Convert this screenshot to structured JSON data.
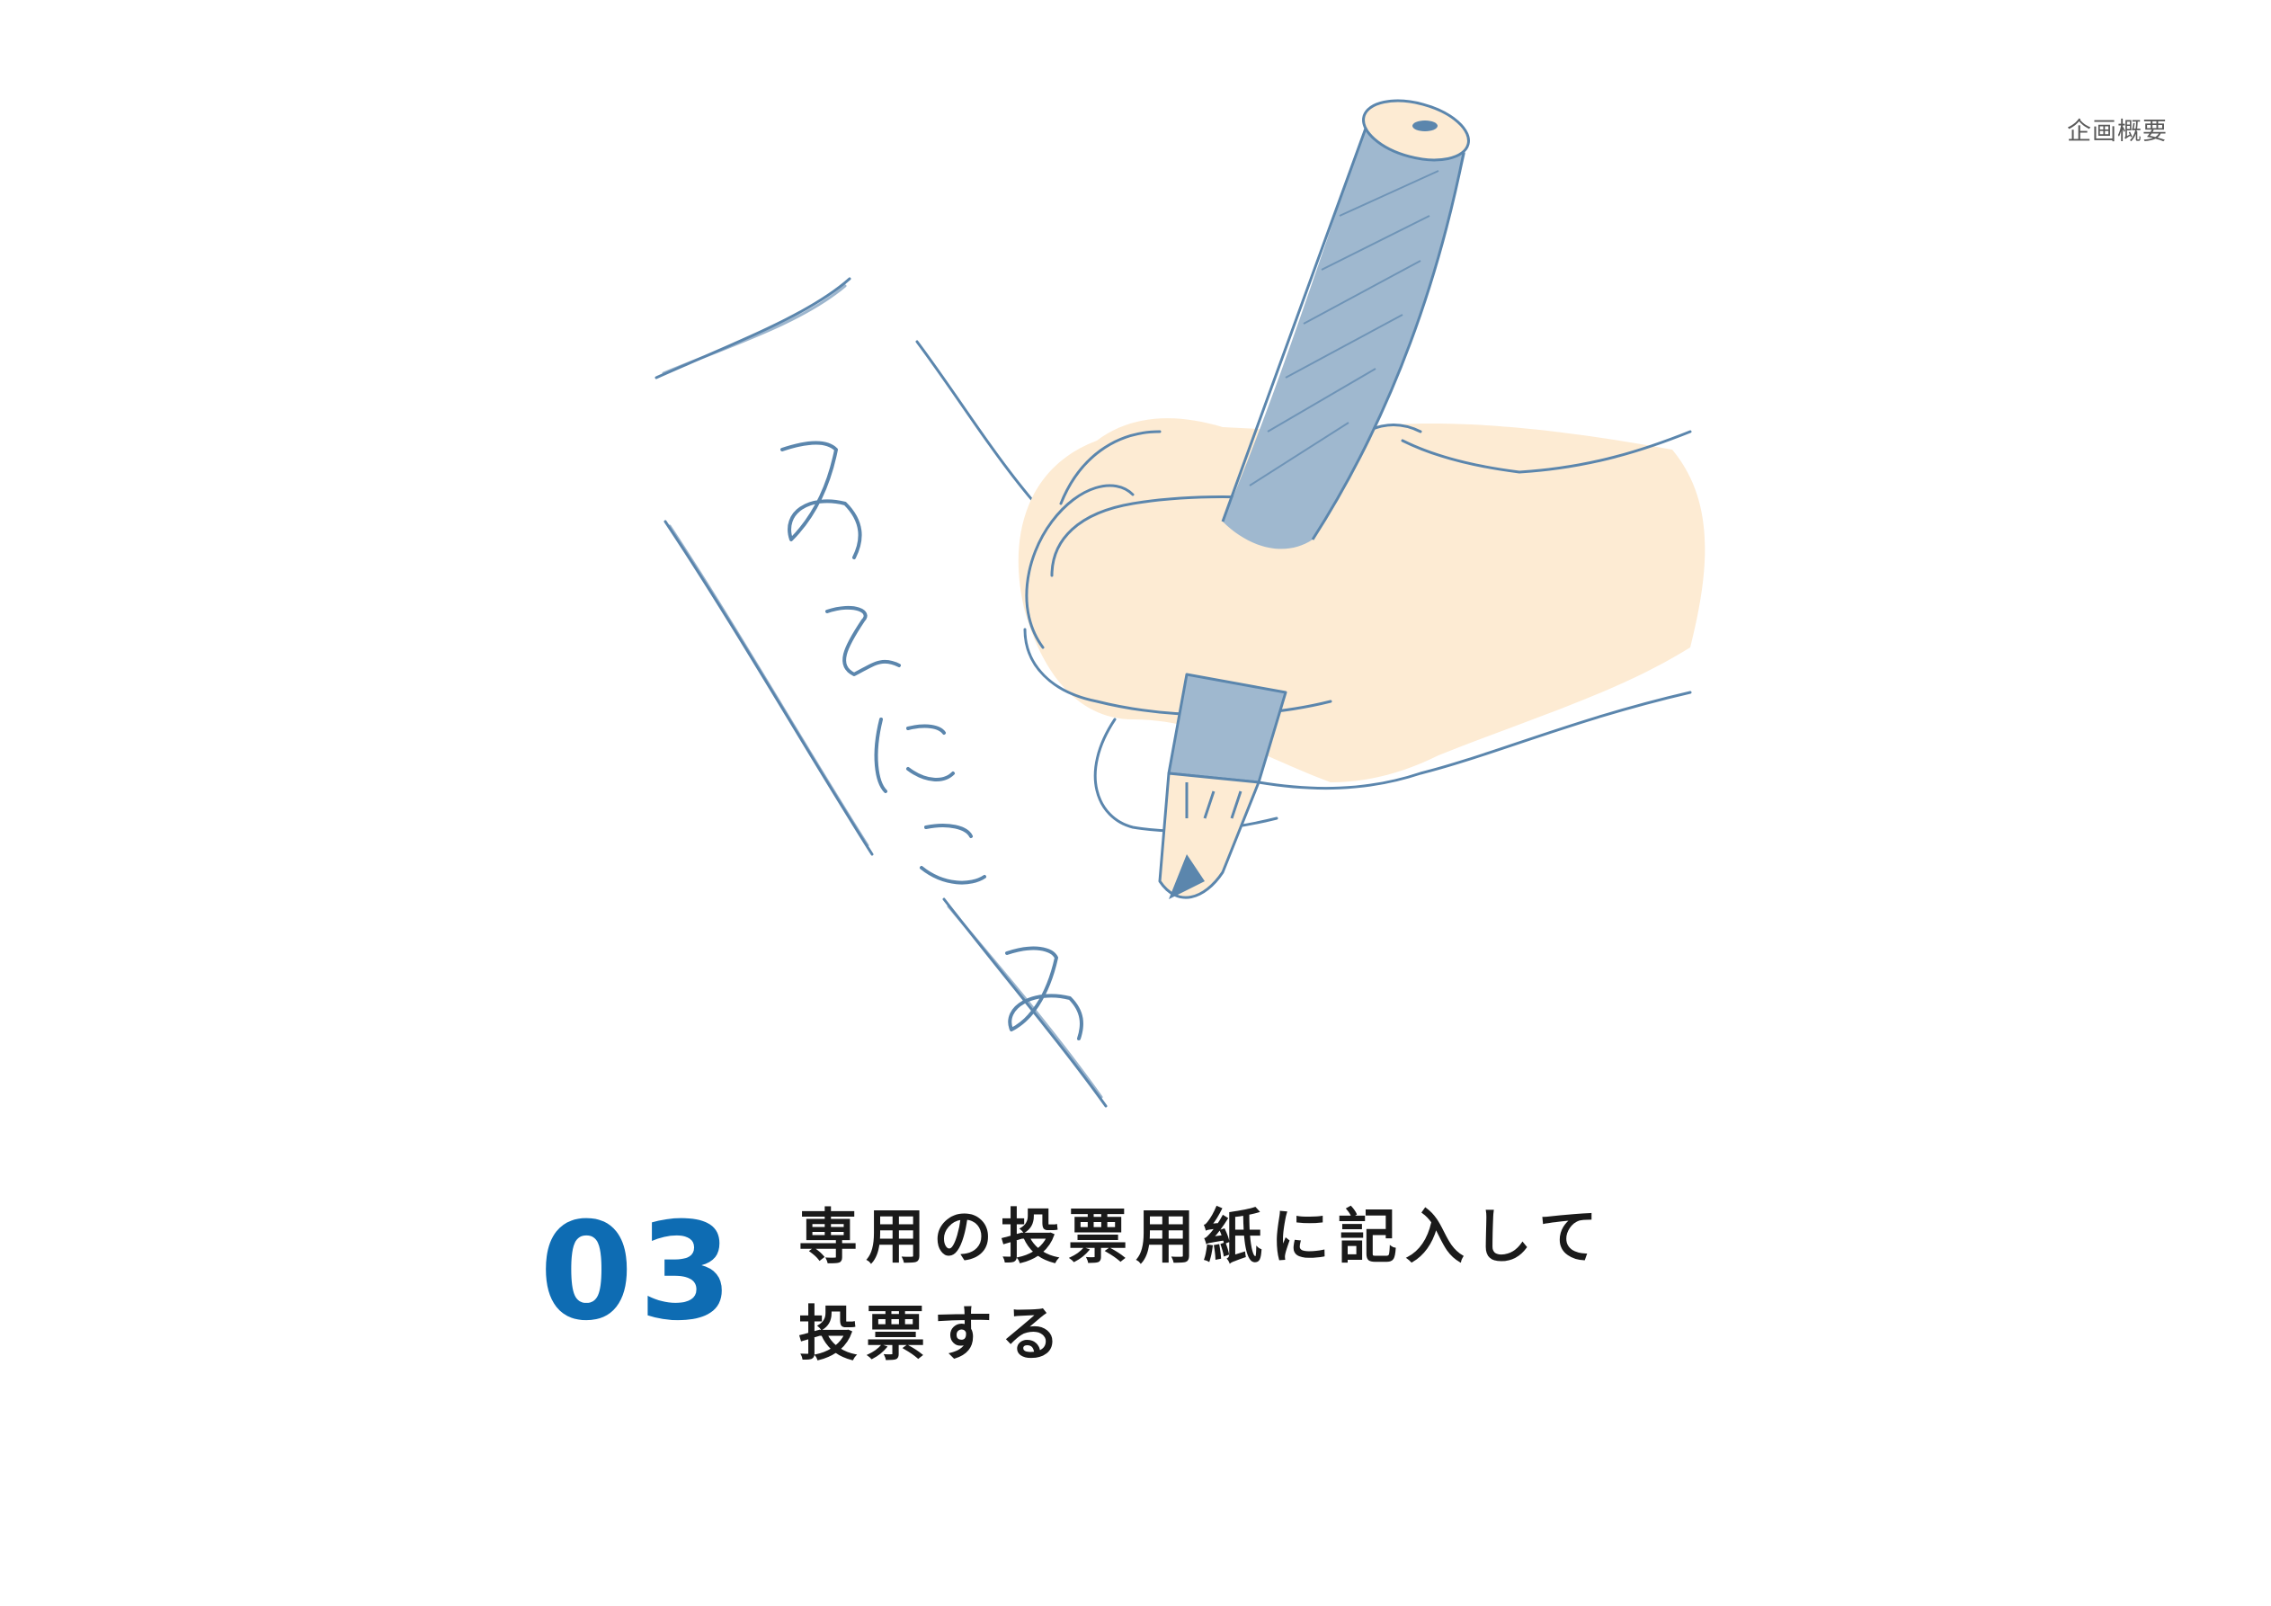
{
  "header": {
    "section_label": "企画概要"
  },
  "illustration": {
    "handwritten_text": "みえにこみ",
    "colors": {
      "line": "#5b86ad",
      "pencil_fill": "#9fb8cf",
      "skin": "#fdebd3"
    }
  },
  "step": {
    "number": "03",
    "line1": "専用の投票用紙に記入して",
    "line2": "投票する",
    "number_color": "#0e6cb3"
  }
}
